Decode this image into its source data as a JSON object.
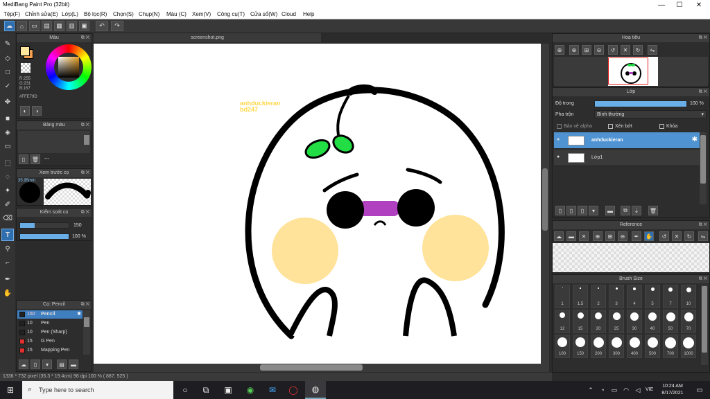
{
  "window": {
    "title": "MediBang Paint Pro (32bit)",
    "minimize": "—",
    "maximize": "☐",
    "close": "✕"
  },
  "menu": [
    "Tệp(F)",
    "Chỉnh sửa(E)",
    "Lớp(L)",
    "Bộ lọc(R)",
    "Chọn(S)",
    "Chụp(N)",
    "Màu (C)",
    "Xem(V)",
    "Công cụ(T)",
    "Cửa sổ(W)",
    "Cloud",
    "Help"
  ],
  "toolbar": {
    "undo": "↶",
    "redo": "↷"
  },
  "document": {
    "tab": "screenshot.png",
    "watermark_line1": "anhduckieran",
    "watermark_line2": "bd247"
  },
  "color_panel": {
    "title": "Màu",
    "rgb_r": "R:255",
    "rgb_g": "G:231",
    "rgb_b": "B:157",
    "hex": "#FFE79D",
    "primary_color": "#FFE79D",
    "secondary_color": "#f0a050"
  },
  "palette_panel": {
    "title": "Bảng màu",
    "value": "---"
  },
  "brush_preview_panel": {
    "title": "Xem trước cọ",
    "size": "35.95mm"
  },
  "brush_control_panel": {
    "title": "Kiểm soát cọ",
    "size_value": "150",
    "opacity_value": "100 %",
    "size_fraction": 0.3,
    "opacity_fraction": 1.0
  },
  "brush_list_panel": {
    "title": "Cọ: Pencil",
    "items": [
      {
        "size": "150",
        "name": "Pencil",
        "color": "#222222",
        "selected": true
      },
      {
        "size": "10",
        "name": "Pen",
        "color": "#222222",
        "selected": false
      },
      {
        "size": "10",
        "name": "Pen (Sharp)",
        "color": "#222222",
        "selected": false
      },
      {
        "size": "15",
        "name": "G Pen",
        "color": "#e03030",
        "selected": false
      },
      {
        "size": "15",
        "name": "Mapping Pen",
        "color": "#e03030",
        "selected": false
      }
    ]
  },
  "navigator_panel": {
    "title": "Hoa tiêu"
  },
  "layer_panel": {
    "title": "Lớp",
    "opacity_label": "Độ trong",
    "opacity_value": "100 %",
    "blend_label": "Pha trộn",
    "blend_value": "Bình thường",
    "protect_alpha": "Bảo vệ alpha",
    "clipping": "Xén bớt",
    "lock": "Khóa",
    "layers": [
      {
        "name": "anhduckieran",
        "selected": true
      },
      {
        "name": "Lớp1",
        "selected": false
      }
    ]
  },
  "reference_panel": {
    "title": "Reference"
  },
  "brush_size_panel": {
    "title": "Brush Size",
    "sizes": [
      "1",
      "1.5",
      "2",
      "3",
      "4",
      "5",
      "7",
      "10",
      "12",
      "15",
      "20",
      "25",
      "30",
      "40",
      "50",
      "70",
      "100",
      "150",
      "200",
      "300",
      "400",
      "500",
      "700",
      "1000"
    ]
  },
  "status": {
    "text": "1336 * 732 pixel   (35.3 * 19.4cm)  96 dpi  100 %  ( 887, 525 )"
  },
  "taskbar": {
    "search_placeholder": "Type here to search",
    "time": "10:24 AM",
    "date": "8/17/2021",
    "lang": "VIE"
  }
}
